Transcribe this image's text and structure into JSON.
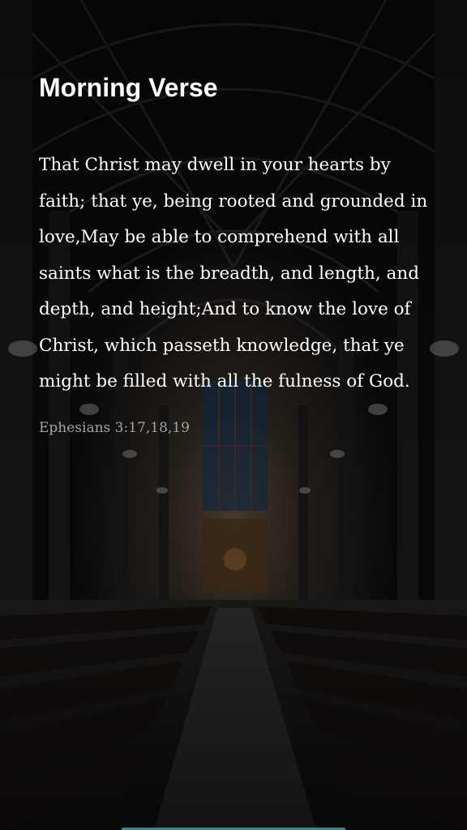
{
  "header": {
    "title": "Morning Verse"
  },
  "verse": {
    "text": "That Christ may dwell in your hearts by faith; that ye, being rooted and grounded in love,May be able to comprehend with all saints what is the breadth, and length, and depth, and height;And to know the love of Christ, which passeth knowledge, that ye might be filled with all the fulness of God.",
    "reference": "Ephesians 3:17,18,19"
  },
  "colors": {
    "title": "#ffffff",
    "verse": "#ffffff",
    "reference": "#a9a39b",
    "accent_bar": "#2d8e8e"
  },
  "background": {
    "icon": "cathedral-interior-image"
  }
}
